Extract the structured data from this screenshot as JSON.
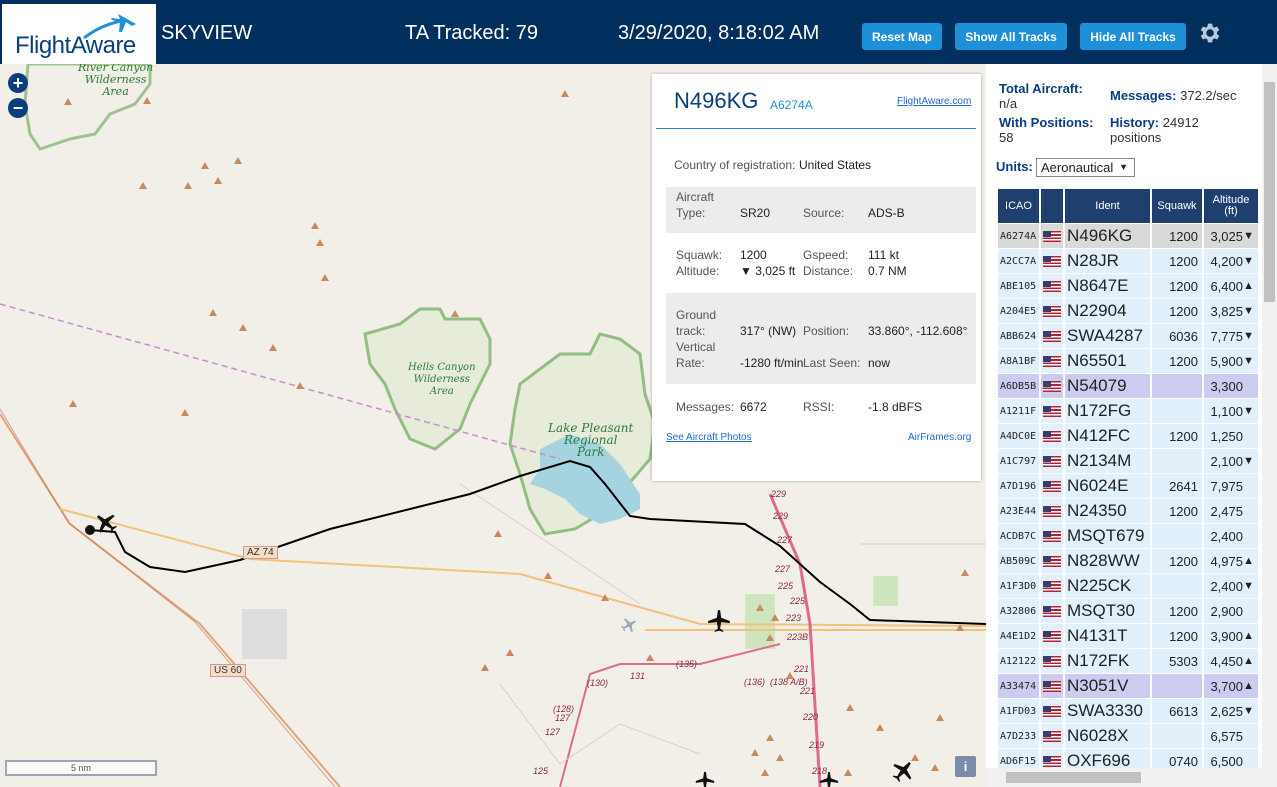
{
  "header": {
    "logo_text": "FlightAware",
    "app_name": "SKYVIEW",
    "tracked_label": "TA Tracked: 79",
    "datetime": "3/29/2020, 8:18:02 AM",
    "reset_map": "Reset Map",
    "show_tracks": "Show All Tracks",
    "hide_tracks": "Hide All Tracks"
  },
  "map": {
    "zoom_in": "+",
    "zoom_out": "−",
    "scale_label": "5 nm",
    "info": "i",
    "labels": {
      "river_canyon": "River Canyon\nWilderness\nArea",
      "hells_canyon": "Hells Canyon\nWilderness\nArea",
      "lake_pleasant": "Lake Pleasant\nRegional\nPark",
      "az74": "AZ 74",
      "us60": "US 60"
    },
    "road_numbers": [
      "229",
      "229",
      "227",
      "227",
      "225",
      "225",
      "223",
      "223B",
      "221",
      "221",
      "220",
      "219",
      "218",
      "(135)",
      "(136)",
      "(138 A/B)",
      "131",
      "(130)",
      "(128)",
      "127",
      "127",
      "125"
    ]
  },
  "popup": {
    "ident": "N496KG",
    "icao": "A6274A",
    "fa_link": "FlightAware.com",
    "country_label": "Country of registration:",
    "country": "United States",
    "aircraft_type_label": "Aircraft Type:",
    "aircraft_type_label_1": "Aircraft",
    "aircraft_type_label_2": "Type:",
    "aircraft_type": "SR20",
    "source_label": "Source:",
    "source": "ADS-B",
    "squawk_label": "Squawk:",
    "squawk": "1200",
    "gspeed_label": "Gspeed:",
    "gspeed": "111 kt",
    "altitude_label": "Altitude:",
    "altitude": "▼ 3,025 ft",
    "distance_label": "Distance:",
    "distance": "0.7 NM",
    "ground_track_label_1": "Ground",
    "ground_track_label_2": "track:",
    "ground_track": "317° (NW)",
    "position_label": "Position:",
    "position": "33.860°, -112.608°",
    "vrate_label_1": "Vertical",
    "vrate_label_2": "Rate:",
    "vrate": "-1280 ft/min",
    "last_seen_label": "Last Seen:",
    "last_seen": "now",
    "messages_label": "Messages:",
    "messages": "6672",
    "rssi_label": "RSSI:",
    "rssi": "-1.8 dBFS",
    "photos_link": "See Aircraft Photos",
    "airframes_link": "AirFrames.org"
  },
  "stats": {
    "total_label": "Total Aircraft:",
    "total": "n/a",
    "messages_label": "Messages:",
    "messages": "372.2/sec",
    "positions_label": "With Positions:",
    "positions": "58",
    "history_label": "History:",
    "history": "24912",
    "history_unit": "positions",
    "units_label": "Units:",
    "units_value": "Aeronautical"
  },
  "table": {
    "headers": [
      "ICAO",
      "",
      "Ident",
      "Squawk",
      "Altitude\n(ft)"
    ],
    "rows": [
      {
        "icao": "A6274A",
        "ident": "N496KG",
        "squawk": "1200",
        "alt": "3,025",
        "trend": "▼",
        "hl": "sel"
      },
      {
        "icao": "A2CC7A",
        "ident": "N28JR",
        "squawk": "1200",
        "alt": "4,200",
        "trend": "▼",
        "hl": ""
      },
      {
        "icao": "ABE105",
        "ident": "N8647E",
        "squawk": "1200",
        "alt": "6,400",
        "trend": "▲",
        "hl": ""
      },
      {
        "icao": "A204E5",
        "ident": "N22904",
        "squawk": "1200",
        "alt": "3,825",
        "trend": "▼",
        "hl": ""
      },
      {
        "icao": "ABB624",
        "ident": "SWA4287",
        "squawk": "6036",
        "alt": "7,775",
        "trend": "▼",
        "hl": ""
      },
      {
        "icao": "A8A1BF",
        "ident": "N65501",
        "squawk": "1200",
        "alt": "5,900",
        "trend": "▼",
        "hl": ""
      },
      {
        "icao": "A6DB5B",
        "ident": "N54079",
        "squawk": "",
        "alt": "3,300",
        "trend": "",
        "hl": "mlat"
      },
      {
        "icao": "A1211F",
        "ident": "N172FG",
        "squawk": "",
        "alt": "1,100",
        "trend": "▼",
        "hl": ""
      },
      {
        "icao": "A4DC0E",
        "ident": "N412FC",
        "squawk": "1200",
        "alt": "1,250",
        "trend": "",
        "hl": ""
      },
      {
        "icao": "A1C797",
        "ident": "N2134M",
        "squawk": "",
        "alt": "2,100",
        "trend": "▼",
        "hl": ""
      },
      {
        "icao": "A7D196",
        "ident": "N6024E",
        "squawk": "2641",
        "alt": "7,975",
        "trend": "",
        "hl": ""
      },
      {
        "icao": "A23E44",
        "ident": "N24350",
        "squawk": "1200",
        "alt": "2,475",
        "trend": "",
        "hl": ""
      },
      {
        "icao": "ACDB7C",
        "ident": "MSQT679",
        "squawk": "",
        "alt": "2,400",
        "trend": "",
        "hl": ""
      },
      {
        "icao": "AB509C",
        "ident": "N828WW",
        "squawk": "1200",
        "alt": "4,975",
        "trend": "▲",
        "hl": ""
      },
      {
        "icao": "A1F3D0",
        "ident": "N225CK",
        "squawk": "",
        "alt": "2,400",
        "trend": "▼",
        "hl": ""
      },
      {
        "icao": "A32806",
        "ident": "MSQT30",
        "squawk": "1200",
        "alt": "2,900",
        "trend": "",
        "hl": ""
      },
      {
        "icao": "A4E1D2",
        "ident": "N4131T",
        "squawk": "1200",
        "alt": "3,900",
        "trend": "▲",
        "hl": ""
      },
      {
        "icao": "A12122",
        "ident": "N172FK",
        "squawk": "5303",
        "alt": "4,450",
        "trend": "▲",
        "hl": ""
      },
      {
        "icao": "A33474",
        "ident": "N3051V",
        "squawk": "",
        "alt": "3,700",
        "trend": "▲",
        "hl": "mlat"
      },
      {
        "icao": "A1FD03",
        "ident": "SWA3330",
        "squawk": "6613",
        "alt": "2,625",
        "trend": "▼",
        "hl": ""
      },
      {
        "icao": "A7D233",
        "ident": "N6028X",
        "squawk": "",
        "alt": "6,575",
        "trend": "",
        "hl": ""
      },
      {
        "icao": "AD6F15",
        "ident": "OXF696",
        "squawk": "0740",
        "alt": "6,500",
        "trend": "",
        "hl": ""
      }
    ]
  },
  "colors": {
    "header_bg": "#002f5d",
    "button_bg": "#1e90d8",
    "row_bg": "#e1f0fa",
    "row_selected": "#d9d9d9",
    "row_mlat": "#ccccf0",
    "track_line": "#000000",
    "wilderness": "#7cb16a",
    "lake": "#a6d3e0"
  },
  "icons": [
    "plane-icon",
    "gear-icon",
    "zoom-in-icon",
    "zoom-out-icon",
    "info-icon",
    "us-flag-icon"
  ]
}
